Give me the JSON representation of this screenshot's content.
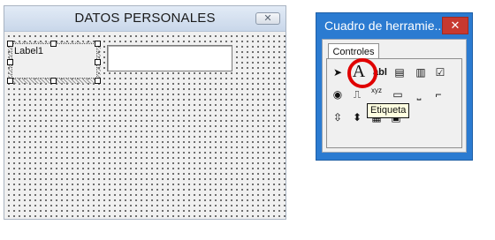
{
  "form": {
    "title": "DATOS PERSONALES",
    "close_glyph": "✕",
    "label_text": "Label1"
  },
  "toolbox": {
    "title": "Cuadro de herramie...",
    "close_glyph": "✕",
    "tab_label": "Controles",
    "tooltip": "Etiqueta",
    "tools": {
      "select": "➤",
      "label": "A",
      "textbox": "abl",
      "combobox": "▤",
      "listbox": "▥",
      "checkbox": "☑",
      "option": "◉",
      "toggle": "⎍",
      "frame": "xyz",
      "button": "▭",
      "tabstrip": "⎵",
      "multipage": "⌐",
      "scrollbar": "⇳",
      "spinbutton": "⬍",
      "image": "▦",
      "refedit": "▣"
    }
  },
  "colors": {
    "highlight_circle": "#e00000",
    "toolbox_titlebar": "#2b7bd1",
    "toolbox_close": "#c7392f"
  }
}
